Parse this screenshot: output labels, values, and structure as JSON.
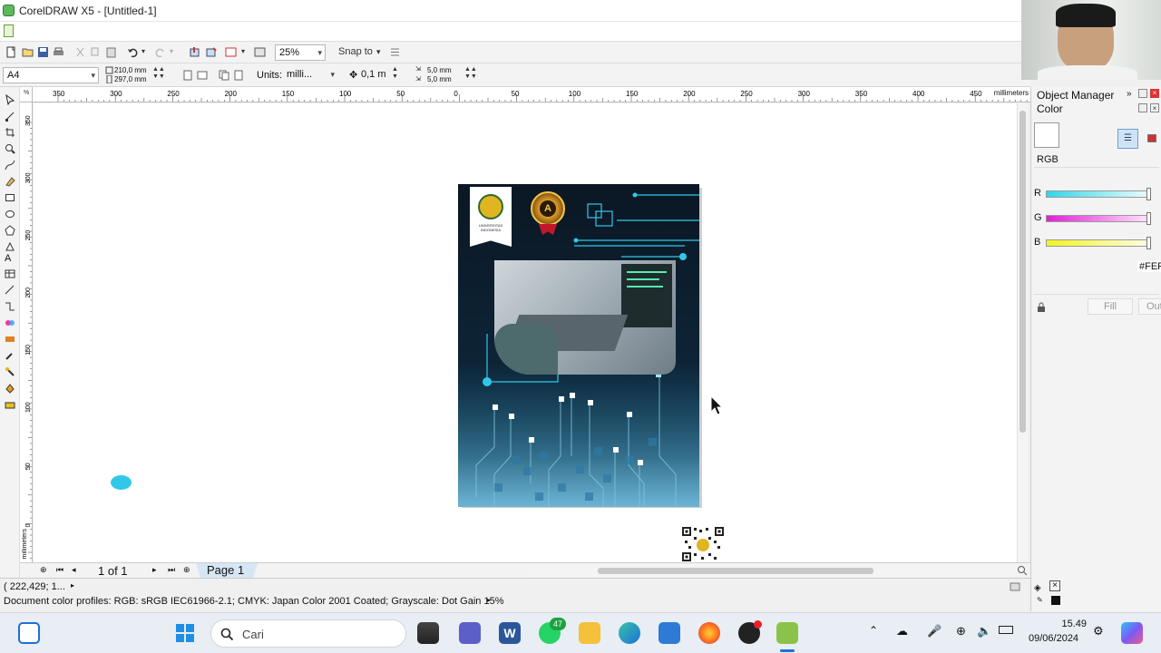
{
  "window": {
    "title": "CorelDRAW X5 - [Untitled-1]"
  },
  "toolbar": {
    "zoom": "25%",
    "snap_label": "Snap to"
  },
  "propertybar": {
    "paper_size": "A4",
    "width": "210,0 mm",
    "height": "297,0 mm",
    "units_label": "Units:",
    "units_value": "milli...",
    "nudge": "0,1 m",
    "dup_x": "5,0 mm",
    "dup_y": "5,0 mm"
  },
  "ruler": {
    "units": "millimeters",
    "corner": "%",
    "h_ticks": [
      "350",
      "300",
      "250",
      "200",
      "150",
      "100",
      "50",
      "0",
      "50",
      "100",
      "150",
      "200",
      "250",
      "300",
      "350",
      "400",
      "450"
    ],
    "v_ticks": [
      "350",
      "300",
      "250",
      "200",
      "150",
      "100",
      "50",
      "0"
    ],
    "v_units": "millimeters"
  },
  "page_nav": {
    "count": "1 of 1",
    "tab": "Page 1"
  },
  "status": {
    "cursor_pos": "( 222,429; 1... ",
    "color_profiles": "Document color profiles: RGB: sRGB IEC61966-2.1; CMYK: Japan Color 2001 Coated; Grayscale: Dot Gain 15%"
  },
  "panel": {
    "header": "Object Manager",
    "title": "Color",
    "model": "RGB",
    "channels": [
      {
        "label": "R",
        "color": "#31d7e8"
      },
      {
        "label": "G",
        "color": "#e020d8"
      },
      {
        "label": "B",
        "color": "#f3f320"
      }
    ],
    "hex": "#FEF",
    "fill_btn": "Fill",
    "outline_btn": "Out"
  },
  "poster": {
    "logo_text": "UNIVERSITAS INDONESIA",
    "badge_letter": "A"
  },
  "taskbar": {
    "search_placeholder": "Cari",
    "whatsapp_badge": "47",
    "time": "15.49",
    "date": "09/06/2024"
  },
  "colors": {
    "accent": "#31c8e8",
    "page_tab": "#d6e6f5"
  }
}
